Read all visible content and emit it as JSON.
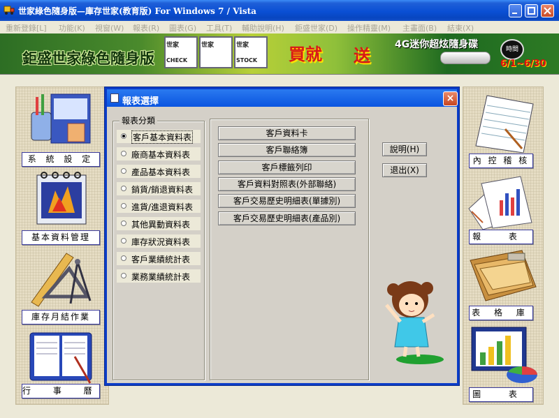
{
  "window": {
    "title": "世家綠色隨身版—庫存世家(教育版) For Windows 7 / Vista"
  },
  "menu": [
    "重新登錄[L]",
    "功能(K)",
    "視窗(W)",
    "報表(R)",
    "圖表(G)",
    "工具(T)",
    "輔助說明(H)",
    "鉅盛世家(D)",
    "操作精靈(M)",
    "主畫面(B)",
    "結束(X)"
  ],
  "banner": {
    "title": "鉅盛世家綠色隨身版",
    "products": [
      "世家",
      "世家",
      "世家"
    ],
    "product_tags": [
      "CHECK",
      "STOCK"
    ],
    "promo_buy": "買就",
    "promo_gift": "送",
    "usb_text": "4G迷你超炫隨身碟",
    "clock": "時間",
    "date_range": "6/1~6/30"
  },
  "left_nav": [
    "系 統 設 定",
    "基本資料管理",
    "庫存月結作業",
    "行 事 曆"
  ],
  "right_nav": [
    "內 控 稽 核",
    "報  表",
    "表 格 庫",
    "圖  表"
  ],
  "dialog": {
    "title": "報表選擇",
    "close": "×",
    "group_label": "報表分類",
    "categories": [
      "客戶基本資料表",
      "廠商基本資料表",
      "產品基本資料表",
      "銷貨/銷退資料表",
      "進貨/進退資料表",
      "其他異動資料表",
      "庫存狀況資料表",
      "客戶業績統計表",
      "業務業績統計表"
    ],
    "selected_category": 0,
    "reports": [
      "客戶資料卡",
      "客戶聯絡簿",
      "客戶標籤列印",
      "客戶資料對照表(外部聯絡)",
      "客戶交易歷史明細表(單據別)",
      "客戶交易歷史明細表(產品別)"
    ],
    "help_button": "說明(H)",
    "exit_button": "退出(X)"
  },
  "colors": {
    "titlebar": "#0a4fd4",
    "dialog_border": "#0a3cc8",
    "dialog_body": "#d4d0c8",
    "radio_bg": "#ece9d8",
    "nav_border": "#3c3c9c"
  }
}
